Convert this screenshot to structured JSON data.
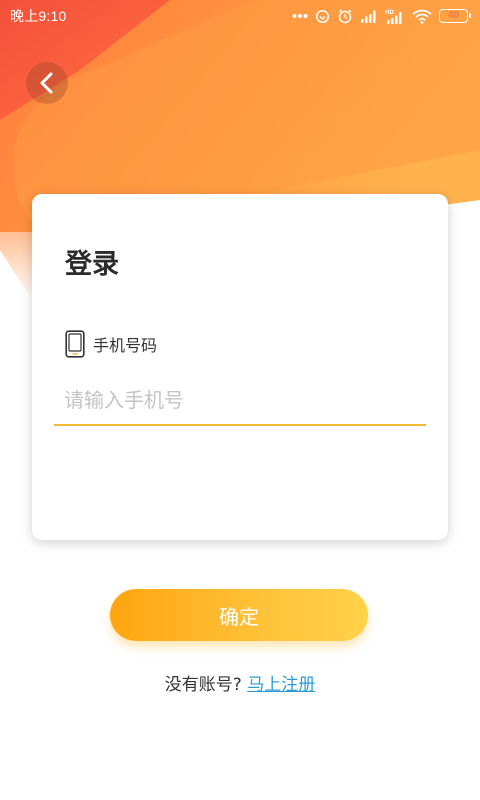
{
  "status_bar": {
    "time": "晚上9:10",
    "battery": "40",
    "battery_level": 0.4,
    "icons": [
      "more-dots-icon",
      "sync-icon",
      "alarm-icon",
      "signal-icon",
      "hd-signal-icon",
      "wifi-icon",
      "battery-icon"
    ]
  },
  "header": {
    "back_icon": "chevron-left-icon"
  },
  "login": {
    "title": "登录",
    "phone_label": "手机号码",
    "phone_icon": "phone-icon",
    "phone_value": "",
    "phone_placeholder": "请输入手机号"
  },
  "actions": {
    "confirm_label": "确定",
    "no_account_text": "没有账号?",
    "register_label": "马上注册"
  },
  "colors": {
    "header_orange": "#ff8a3a",
    "header_red": "#f65a3a",
    "button_gradient_start": "#ffa50f",
    "button_gradient_end": "#ffd24a",
    "input_underline": "#f2bb3a",
    "link": "#2b9bd8"
  }
}
